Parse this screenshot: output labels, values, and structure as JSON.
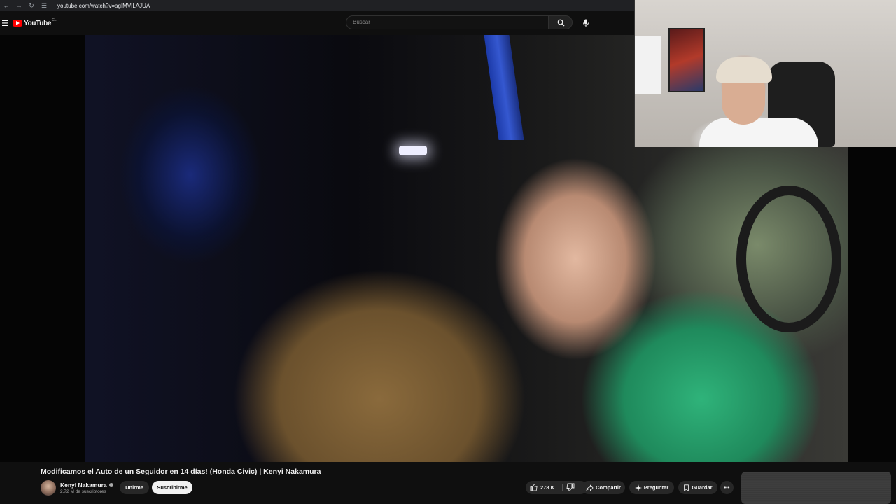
{
  "browser": {
    "url": "youtube.com/watch?v=agIMVILAJUA"
  },
  "header": {
    "logo_text": "YouTube",
    "country_code": "CL",
    "search_placeholder": "Buscar",
    "icons": [
      "menu-icon",
      "search-icon",
      "mic-icon"
    ]
  },
  "video": {
    "title": "Modificamos el Auto de un Seguidor en 14 días! (Honda Civic) | Kenyi Nakamura"
  },
  "channel": {
    "name": "Kenyi Nakamura",
    "subscribers": "2,72 M de suscriptores",
    "join_label": "Unirme",
    "subscribe_label": "Suscribirme"
  },
  "actions": {
    "likes": "278 K",
    "share_label": "Compartir",
    "ask_label": "Preguntar",
    "save_label": "Guardar",
    "more_label": "•••"
  },
  "colors": {
    "background": "#0f0f0f",
    "brand_red": "#ff0000",
    "pill_bg": "#272727",
    "subscribe_bg": "#f1f1f1"
  }
}
